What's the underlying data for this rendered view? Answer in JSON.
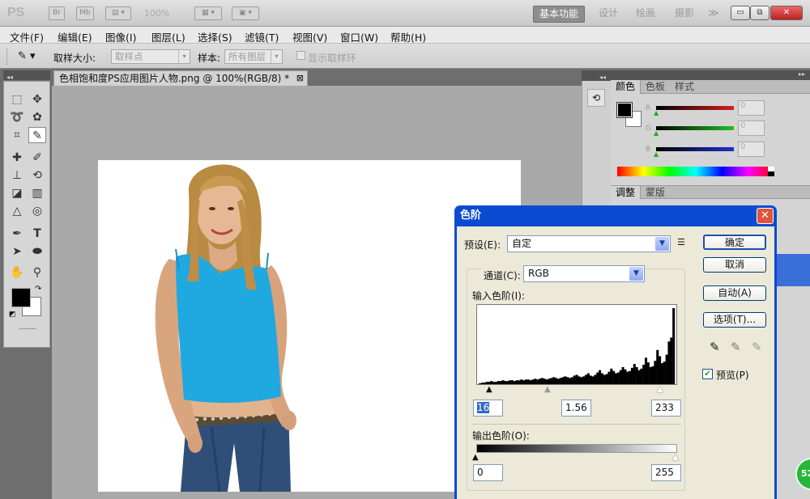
{
  "app": {
    "logo": "PS",
    "zoom": "100%"
  },
  "workspace": [
    "基本功能",
    "设计",
    "绘画",
    "摄影"
  ],
  "window_controls": {
    "minimize": "▭",
    "restore": "⧉",
    "close": "✕"
  },
  "menu": [
    "文件(F)",
    "编辑(E)",
    "图像(I)",
    "图层(L)",
    "选择(S)",
    "滤镜(T)",
    "视图(V)",
    "窗口(W)",
    "帮助(H)"
  ],
  "options": {
    "sample_size_label": "取样大小:",
    "sample_size_value": "取样点",
    "sample_label": "样本:",
    "sample_value": "所有图层",
    "show_ring_label": "显示取样环"
  },
  "document": {
    "tab_title": "色相饱和度PS应用图片人物.png @ 100%(RGB/8) *",
    "close": "⊠"
  },
  "panels": {
    "color_tabs": [
      "颜色",
      "色板",
      "样式"
    ],
    "adjust_tabs": [
      "调整",
      "蒙版"
    ],
    "rgb_labels": [
      "R",
      "G",
      "B"
    ],
    "rgb_values": [
      "0",
      "0",
      "0"
    ],
    "colors": {
      "red": "#d42020",
      "green": "#20c020",
      "blue": "#2030d0"
    }
  },
  "levels_dialog": {
    "title": "色阶",
    "preset_label": "预设(E):",
    "preset_value": "自定",
    "channel_label": "通道(C):",
    "channel_value": "RGB",
    "input_label": "输入色阶(I):",
    "output_label": "输出色阶(O):",
    "input_black": "16",
    "input_gamma": "1.56",
    "input_white": "233",
    "output_black": "0",
    "output_white": "255",
    "ok": "确定",
    "cancel": "取消",
    "auto": "自动(A)",
    "options": "选项(T)...",
    "preview_label": "预览(P)",
    "preview_checked": true,
    "histogram_levels": [
      1,
      2,
      2,
      3,
      3,
      4,
      3,
      3,
      4,
      4,
      5,
      4,
      4,
      5,
      5,
      4,
      5,
      5,
      6,
      5,
      6,
      6,
      5,
      6,
      7,
      6,
      7,
      8,
      7,
      6,
      7,
      8,
      9,
      8,
      7,
      8,
      9,
      10,
      9,
      8,
      9,
      11,
      12,
      10,
      9,
      10,
      12,
      14,
      11,
      10,
      12,
      15,
      18,
      14,
      12,
      13,
      16,
      20,
      17,
      14,
      15,
      18,
      22,
      19,
      16,
      17,
      21,
      26,
      22,
      18,
      20,
      25,
      34,
      28,
      22,
      23,
      30,
      44,
      36,
      27,
      29,
      38,
      55,
      60,
      98
    ]
  },
  "badge": "52"
}
